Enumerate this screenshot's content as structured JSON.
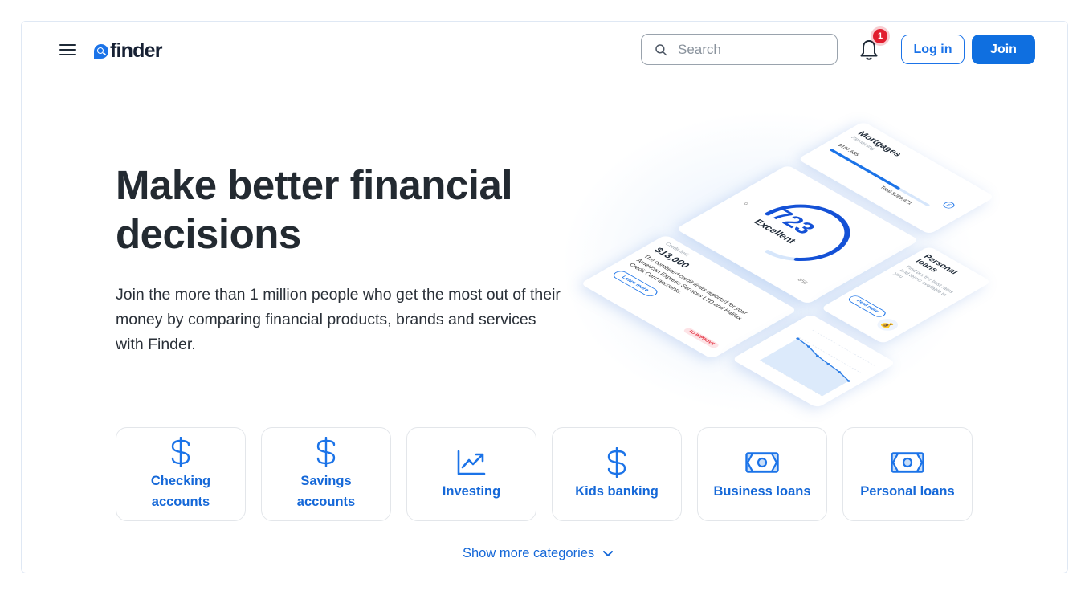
{
  "header": {
    "menu_icon": "hamburger-icon",
    "logo_text": "finder",
    "search": {
      "placeholder": "Search",
      "value": ""
    },
    "notifications": {
      "icon": "bell-icon",
      "count": "1"
    },
    "login_label": "Log in",
    "join_label": "Join"
  },
  "hero": {
    "title": "Make better financial decisions",
    "subtitle": "Join the more than 1 million people who get the most out of their money by comparing financial products, brands and services with Finder."
  },
  "illustration": {
    "credit_score": {
      "value": "723",
      "rating": "Excellent",
      "min": "0",
      "max": "850",
      "fill_fraction": 0.85
    },
    "mortgage": {
      "title": "Mortgages",
      "subtitle": "Remaining",
      "remaining": "$197,655",
      "total": "Total $280,471",
      "progress_fraction": 0.7,
      "icon": "pound-icon"
    },
    "personal_loans": {
      "title": "Personal loans",
      "description": "Find out the best rates and terms available to you",
      "button": "Read more",
      "icon": "money-bag-icon"
    },
    "credit_limit": {
      "label": "Credit limit",
      "amount": "$13,000",
      "description": "The combined credit limits reported for your American Express Services LTD and Halifax Credit Card accounts.",
      "button": "Learn more",
      "badge": "TO IMPROVE"
    },
    "trend_chart": {
      "points": [
        720,
        690,
        620,
        590,
        560,
        500
      ]
    }
  },
  "categories": [
    {
      "label": "Checking accounts",
      "icon": "dollar-icon"
    },
    {
      "label": "Savings accounts",
      "icon": "dollar-icon"
    },
    {
      "label": "Investing",
      "icon": "trend-chart-icon"
    },
    {
      "label": "Kids banking",
      "icon": "dollar-icon"
    },
    {
      "label": "Business loans",
      "icon": "banknote-icon"
    },
    {
      "label": "Personal loans",
      "icon": "banknote-icon"
    }
  ],
  "show_more": {
    "label": "Show more categories",
    "icon": "chevron-down-icon"
  },
  "colors": {
    "brand": "#1b73e8",
    "link": "#1568d8",
    "badge": "#e11d2e",
    "text": "#232a31"
  }
}
